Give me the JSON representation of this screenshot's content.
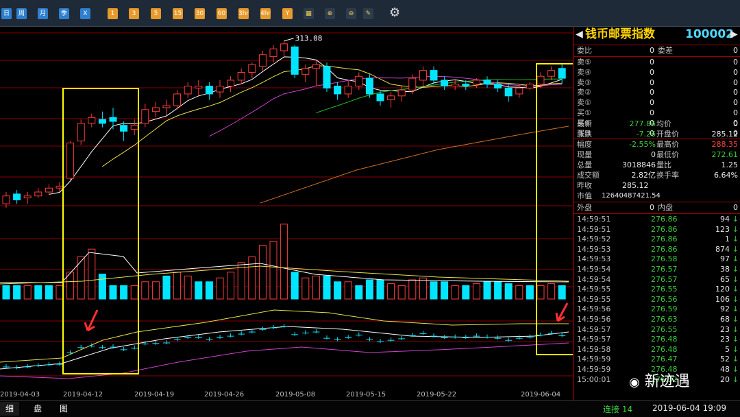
{
  "toolbar": {
    "buttons": [
      {
        "label": "日",
        "kind": "blue"
      },
      {
        "label": "周",
        "kind": "blue"
      },
      {
        "label": "月",
        "kind": "blue"
      },
      {
        "label": "季",
        "kind": "blue"
      },
      {
        "label": "X",
        "kind": "blue"
      },
      {
        "label": "1",
        "kind": "orange"
      },
      {
        "label": "3",
        "kind": "orange"
      },
      {
        "label": "5",
        "kind": "orange"
      },
      {
        "label": "15",
        "kind": "orange"
      },
      {
        "label": "30",
        "kind": "orange"
      },
      {
        "label": "60",
        "kind": "orange"
      },
      {
        "label": "3hr",
        "kind": "orange"
      },
      {
        "label": "4hr",
        "kind": "orange"
      },
      {
        "label": "Y",
        "kind": "orange"
      },
      {
        "label": "",
        "kind": "icon",
        "icon": "chart-tool-icon"
      },
      {
        "label": "",
        "kind": "icon",
        "icon": "zoom-in-icon"
      },
      {
        "label": "",
        "kind": "icon",
        "icon": "zoom-out-icon"
      },
      {
        "label": "",
        "kind": "icon",
        "icon": "draw-line-icon"
      }
    ],
    "settings_icon": "gear-icon"
  },
  "panel": {
    "title": "钱币邮票指数",
    "code": "100002",
    "weibi_label": "委比",
    "weibi_value": "0",
    "weicha_label": "委差",
    "weicha_value": "0",
    "book": [
      {
        "label": "卖⑤",
        "price": "0",
        "vol": "0"
      },
      {
        "label": "卖④",
        "price": "0",
        "vol": "0"
      },
      {
        "label": "卖③",
        "price": "0",
        "vol": "0"
      },
      {
        "label": "卖②",
        "price": "0",
        "vol": "0"
      },
      {
        "label": "卖①",
        "price": "0",
        "vol": "0"
      },
      {
        "label": "买①",
        "price": "0",
        "vol": "0"
      },
      {
        "label": "买②",
        "price": "0",
        "vol": "0"
      },
      {
        "label": "买③",
        "price": "0",
        "vol": "0"
      }
    ],
    "stats": [
      {
        "l1": "最新",
        "v1": "277.86",
        "c1": "green",
        "l2": "均价",
        "v2": "0",
        "c2": "white"
      },
      {
        "l1": "涨跌",
        "v1": "-7.26",
        "c1": "green",
        "l2": "开盘价",
        "v2": "285.12",
        "c2": "white"
      },
      {
        "l1": "幅度",
        "v1": "-2.55%",
        "c1": "green",
        "l2": "最高价",
        "v2": "288.35",
        "c2": "red"
      },
      {
        "l1": "现量",
        "v1": "0",
        "c1": "white",
        "l2": "最低价",
        "v2": "272.61",
        "c2": "green"
      },
      {
        "l1": "总量",
        "v1": "3018846",
        "c1": "white",
        "l2": "量比",
        "v2": "1.25",
        "c2": "white"
      },
      {
        "l1": "成交额",
        "v1": "2.82亿",
        "c1": "white",
        "l2": "换手率",
        "v2": "6.64%",
        "c2": "white"
      }
    ],
    "zuoshou_label": "昨收",
    "zuoshou_value": "285.12",
    "shizhi_label": "市值",
    "shizhi_value": "12640487421.54",
    "waipan_label": "外盘",
    "waipan_value": "0",
    "neipan_label": "内盘",
    "neipan_value": "0",
    "ticks": [
      {
        "t": "14:59:51",
        "p": "276.86",
        "v": "94"
      },
      {
        "t": "14:59:51",
        "p": "276.86",
        "v": "123"
      },
      {
        "t": "14:59:52",
        "p": "276.86",
        "v": "1"
      },
      {
        "t": "14:59:53",
        "p": "276.86",
        "v": "874"
      },
      {
        "t": "14:59:53",
        "p": "276.58",
        "v": "97"
      },
      {
        "t": "14:59:54",
        "p": "276.57",
        "v": "38"
      },
      {
        "t": "14:59:54",
        "p": "276.57",
        "v": "65"
      },
      {
        "t": "14:59:55",
        "p": "276.55",
        "v": "120"
      },
      {
        "t": "14:59:55",
        "p": "276.56",
        "v": "106"
      },
      {
        "t": "14:59:56",
        "p": "276.59",
        "v": "92"
      },
      {
        "t": "14:59:56",
        "p": "276.63",
        "v": "68"
      },
      {
        "t": "14:59:57",
        "p": "276.55",
        "v": "23"
      },
      {
        "t": "14:59:57",
        "p": "276.48",
        "v": "23"
      },
      {
        "t": "14:59:58",
        "p": "276.48",
        "v": "5"
      },
      {
        "t": "14:59:59",
        "p": "276.47",
        "v": "52"
      },
      {
        "t": "14:59:59",
        "p": "276.48",
        "v": "48"
      },
      {
        "t": "15:00:01",
        "p": "276.32",
        "v": "20"
      }
    ],
    "down_arrow": "↓"
  },
  "tabs": {
    "detail": "细",
    "board": "盘",
    "chart": "图"
  },
  "status": {
    "connection": "连接 14",
    "datetime": "2019-06-04 19:09"
  },
  "watermark": "新迹遇",
  "colors": {
    "up": "#ff3b3b",
    "down": "#00e5ff",
    "ma5": "#ffffff",
    "ma10": "#e8e24a",
    "ma20": "#d040d0",
    "ma60": "#20c020",
    "ma120": "#d07020",
    "highlight": "#ffff00",
    "grid": "#8b0000"
  },
  "chart_data": {
    "type": "candlestick",
    "x_labels": [
      "2019-04-03",
      "2019-04-12",
      "2019-04-19",
      "2019-04-26",
      "2019-05-08",
      "2019-05-15",
      "2019-05-22",
      "2019-06-04"
    ],
    "high_annotation": "313.08",
    "candles": [
      [
        150,
        158,
        146,
        162,
        0
      ],
      [
        160,
        154,
        150,
        164,
        1
      ],
      [
        156,
        158,
        150,
        162,
        0
      ],
      [
        158,
        162,
        156,
        166,
        0
      ],
      [
        162,
        166,
        160,
        170,
        0
      ],
      [
        166,
        168,
        162,
        172,
        0
      ],
      [
        176,
        212,
        174,
        214,
        0
      ],
      [
        214,
        232,
        210,
        236,
        0
      ],
      [
        232,
        238,
        228,
        242,
        0
      ],
      [
        236,
        232,
        228,
        244,
        1
      ],
      [
        238,
        234,
        226,
        248,
        1
      ],
      [
        230,
        224,
        214,
        234,
        1
      ],
      [
        226,
        230,
        220,
        236,
        0
      ],
      [
        232,
        246,
        228,
        252,
        0
      ],
      [
        244,
        248,
        238,
        254,
        0
      ],
      [
        248,
        250,
        240,
        256,
        0
      ],
      [
        250,
        262,
        246,
        266,
        0
      ],
      [
        262,
        270,
        258,
        274,
        0
      ],
      [
        268,
        270,
        260,
        276,
        0
      ],
      [
        270,
        262,
        256,
        274,
        1
      ],
      [
        264,
        270,
        258,
        276,
        0
      ],
      [
        270,
        276,
        264,
        280,
        0
      ],
      [
        276,
        284,
        272,
        288,
        0
      ],
      [
        284,
        292,
        278,
        294,
        0
      ],
      [
        290,
        302,
        286,
        306,
        0
      ],
      [
        300,
        308,
        294,
        312,
        0
      ],
      [
        306,
        313.08,
        300,
        316,
        0
      ],
      [
        310,
        282,
        278,
        312,
        1
      ],
      [
        282,
        288,
        274,
        292,
        0
      ],
      [
        288,
        292,
        270,
        296,
        0
      ],
      [
        290,
        268,
        264,
        294,
        1
      ],
      [
        270,
        262,
        256,
        274,
        1
      ],
      [
        262,
        270,
        258,
        276,
        0
      ],
      [
        270,
        280,
        266,
        284,
        0
      ],
      [
        278,
        262,
        258,
        282,
        1
      ],
      [
        262,
        255,
        250,
        266,
        1
      ],
      [
        256,
        260,
        248,
        264,
        0
      ],
      [
        260,
        266,
        254,
        270,
        0
      ],
      [
        266,
        278,
        262,
        282,
        0
      ],
      [
        276,
        286,
        270,
        290,
        0
      ],
      [
        286,
        276,
        272,
        290,
        1
      ],
      [
        276,
        270,
        266,
        280,
        1
      ],
      [
        270,
        272,
        266,
        276,
        0
      ],
      [
        272,
        270,
        266,
        276,
        1
      ],
      [
        272,
        276,
        268,
        278,
        0
      ],
      [
        276,
        272,
        268,
        280,
        1
      ],
      [
        272,
        268,
        264,
        276,
        1
      ],
      [
        268,
        260,
        254,
        272,
        1
      ],
      [
        262,
        268,
        258,
        272,
        0
      ],
      [
        268,
        272,
        266,
        274,
        0
      ],
      [
        272,
        280,
        268,
        284,
        0
      ],
      [
        280,
        286,
        276,
        290,
        0
      ],
      [
        288,
        278,
        272,
        292,
        1
      ]
    ],
    "volumes": [
      [
        14,
        1
      ],
      [
        14,
        1
      ],
      [
        14,
        0
      ],
      [
        14,
        1
      ],
      [
        14,
        1
      ],
      [
        14,
        0
      ],
      [
        28,
        0
      ],
      [
        44,
        0
      ],
      [
        52,
        0
      ],
      [
        26,
        1
      ],
      [
        14,
        1
      ],
      [
        14,
        1
      ],
      [
        14,
        0
      ],
      [
        18,
        0
      ],
      [
        18,
        0
      ],
      [
        24,
        1
      ],
      [
        28,
        0
      ],
      [
        24,
        0
      ],
      [
        18,
        1
      ],
      [
        18,
        1
      ],
      [
        22,
        0
      ],
      [
        28,
        0
      ],
      [
        38,
        0
      ],
      [
        44,
        0
      ],
      [
        56,
        0
      ],
      [
        60,
        0
      ],
      [
        78,
        0
      ],
      [
        28,
        1
      ],
      [
        22,
        0
      ],
      [
        24,
        0
      ],
      [
        24,
        1
      ],
      [
        18,
        1
      ],
      [
        18,
        0
      ],
      [
        14,
        1
      ],
      [
        20,
        1
      ],
      [
        20,
        1
      ],
      [
        16,
        0
      ],
      [
        14,
        0
      ],
      [
        20,
        0
      ],
      [
        22,
        0
      ],
      [
        18,
        1
      ],
      [
        18,
        1
      ],
      [
        14,
        0
      ],
      [
        14,
        1
      ],
      [
        16,
        0
      ],
      [
        18,
        1
      ],
      [
        18,
        1
      ],
      [
        16,
        1
      ],
      [
        14,
        0
      ],
      [
        14,
        1
      ],
      [
        14,
        0
      ],
      [
        16,
        0
      ],
      [
        14,
        1
      ]
    ]
  }
}
